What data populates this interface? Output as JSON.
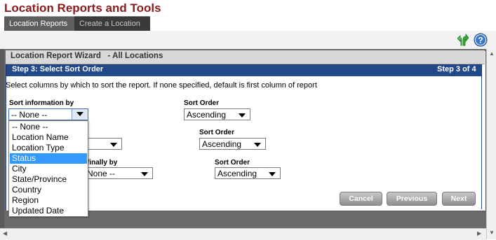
{
  "page_title": "Location Reports and Tools",
  "tabs": [
    {
      "label": "Location Reports"
    },
    {
      "label": "Create a Location"
    }
  ],
  "icons": {
    "refresh": "refresh-arrow-icon",
    "help": "help-icon"
  },
  "wizard": {
    "title": "Location Report Wizard   - All Locations",
    "step_title": "Step 3: Select Sort Order",
    "step_counter": "Step 3 of 4",
    "instructions": "Select columns by which to sort the report. If none specified, default is first column of report"
  },
  "sort1": {
    "label": "Sort information by",
    "value": "-- None --",
    "order_label": "Sort Order",
    "order_value": "Ascending"
  },
  "sort2": {
    "order_label": "Sort Order",
    "order_value": "Ascending"
  },
  "sort3": {
    "label_partial": "finally by",
    "value_partial": "None --",
    "order_label": "Sort Order",
    "order_value": "Ascending"
  },
  "dropdown_options": [
    "-- None --",
    "Location Name",
    "Location Type",
    "Status",
    "City",
    "State/Province",
    "Country",
    "Region",
    "Updated Date"
  ],
  "dropdown_selected": "Status",
  "buttons": {
    "cancel": "Cancel",
    "previous": "Previous",
    "next": "Next"
  },
  "colors": {
    "title": "#8b1a1a",
    "step_bar": "#24498a",
    "highlight": "#3399ff"
  }
}
